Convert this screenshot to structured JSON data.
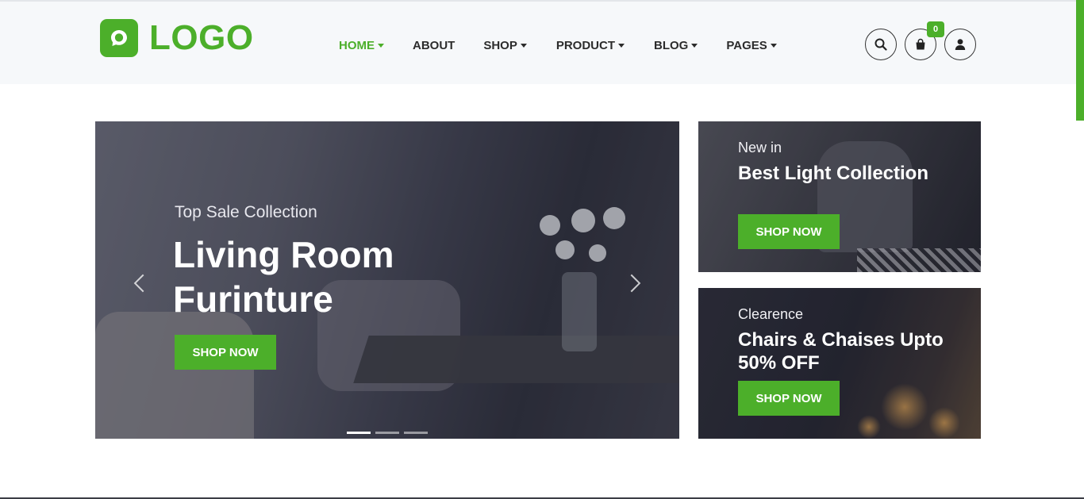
{
  "brand": {
    "logo_text": "LOGO",
    "accent_color": "#4caf2a"
  },
  "nav": {
    "items": [
      {
        "label": "HOME",
        "active": true,
        "has_dropdown": true
      },
      {
        "label": "ABOUT",
        "active": false,
        "has_dropdown": false
      },
      {
        "label": "SHOP",
        "active": false,
        "has_dropdown": true
      },
      {
        "label": "PRODUCT",
        "active": false,
        "has_dropdown": true
      },
      {
        "label": "BLOG",
        "active": false,
        "has_dropdown": true
      },
      {
        "label": "PAGES",
        "active": false,
        "has_dropdown": true
      }
    ]
  },
  "header_icons": {
    "search_icon": "search-icon",
    "cart_icon": "shopping-bag-icon",
    "cart_count": "0",
    "user_icon": "user-icon"
  },
  "hero": {
    "subtitle": "Top Sale Collection",
    "title": "Living Room Furinture",
    "button": "SHOP NOW",
    "slide_count": 3,
    "active_slide": 1
  },
  "promos": [
    {
      "subtitle": "New in",
      "title": "Best Light Collection",
      "button": "SHOP NOW"
    },
    {
      "subtitle": "Clearence",
      "title": "Chairs & Chaises Upto 50% OFF",
      "button": "SHOP NOW"
    }
  ]
}
